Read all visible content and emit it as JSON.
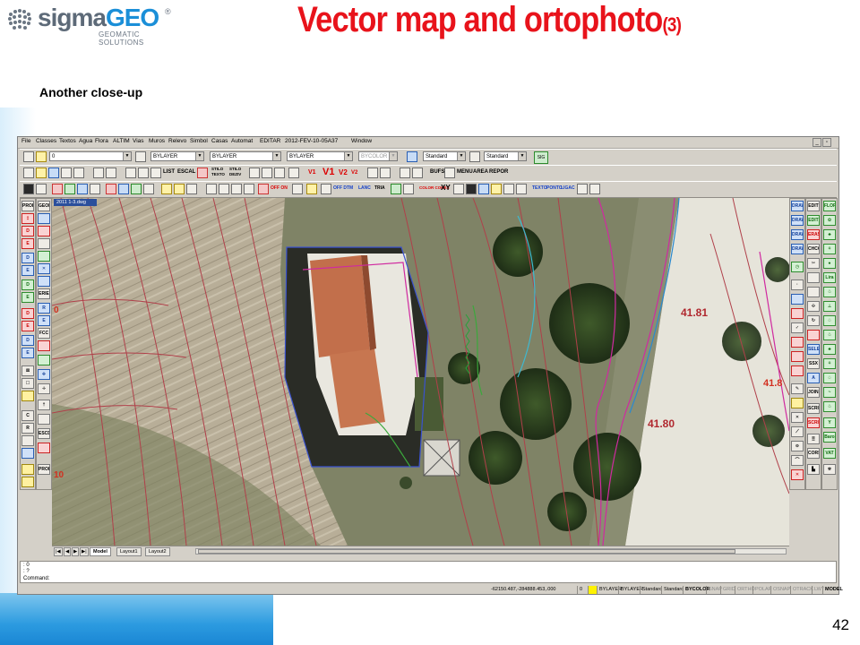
{
  "slide": {
    "logo_sigma": "sigma",
    "logo_geo": "GEO",
    "logo_reg": "®",
    "logo_tagline": "GEOMATIC SOLUTIONS",
    "title": "Vector map and ortophoto",
    "title_suffix": "(3)",
    "subtitle": "Another close-up",
    "page_number": "42",
    "accent_color": "#e8131b",
    "brand_color": "#1b8fd8"
  },
  "app": {
    "menu": [
      "File",
      "Classes",
      "Textos",
      "Agua",
      "Flora",
      "ALTIM",
      "Vias",
      "Muros",
      "Relevo",
      "Simbol",
      "Casas",
      "Automat",
      "EDITAR",
      "2012-FEV-10-05A37",
      "Window"
    ],
    "toolbar1": {
      "layer_combo": "0",
      "color_combo": "BYLAYER",
      "linetype_combo": "BYLAYER",
      "lineweight_combo": "BYLAYER",
      "plotstyle_combo": "BYCOLOR",
      "textstyle_combo": "Standard",
      "dimstyle_combo": "Standard",
      "right_btn": "SIG"
    },
    "toolbar2": {
      "list_label": "LIST",
      "escal_label": "ESCAL",
      "stilo_texto": "STILO TEXTO",
      "stilo_deziv": "STILO DEZIV",
      "v1": "V1",
      "v1_big": "V1",
      "v2_a": "V2",
      "v2_b": "V2",
      "buffs_label": "BUFS",
      "menu_label": "MENU",
      "area_label": "AREA",
      "repor_label": "REPOR"
    },
    "toolbar3": {
      "off_on": "OFF ON",
      "dtm_on": "OFF DTM",
      "lanc": "LANC",
      "tria": "TRIA",
      "color_cores": "COLOR CORES",
      "xy": "XY",
      "texto": "TEXTO",
      "ponto": "PONTO",
      "ligac": "LIGAC"
    },
    "left_panel": [
      "PROL OO1",
      "GEOM OO1",
      "D",
      "E",
      "D",
      "E",
      "D",
      "E",
      "D",
      "E",
      "D",
      "E",
      "ERIE",
      "R",
      "E",
      "FCC",
      "ESCD",
      "C",
      "R",
      "PROL AUTO"
    ],
    "right_panel_a": [
      "DRAW OO1",
      "DRAW 3D",
      "DRAW AUX",
      "DRAW CURV",
      "SELEC",
      "SSX",
      "JOINS",
      "SCRIPT",
      "SCRIPT ERROS",
      "CORS"
    ],
    "right_panel_b": [
      "EDIT OO1",
      "EDIT 2D",
      "ERASE AUX",
      "CHCOL",
      "FLOR OO1",
      "Lira",
      "Baro Flor",
      "VAT Pinte"
    ],
    "document_tab": "2011 1-3.dwg",
    "layout_tabs": [
      "Model",
      "Layout1",
      "Layout2"
    ],
    "command_lines": [
      ": 0",
      ": ?",
      "Command:"
    ],
    "coordinates": "-62150.487,-284888.453,.000",
    "status_items": [
      "0",
      "BYLAYER",
      "BYLAYER",
      "Standard",
      "Standard",
      "BYCOLOR",
      "SNAP",
      "GRID",
      "ORTHO",
      "POLAR",
      "OSNAP",
      "OTRACK",
      "LWT",
      "MODEL"
    ],
    "map_labels": {
      "contour_a": "41.81",
      "contour_b": "41.80",
      "contour_c": "41.8",
      "left_label_a": "0",
      "left_label_b": "10"
    }
  }
}
